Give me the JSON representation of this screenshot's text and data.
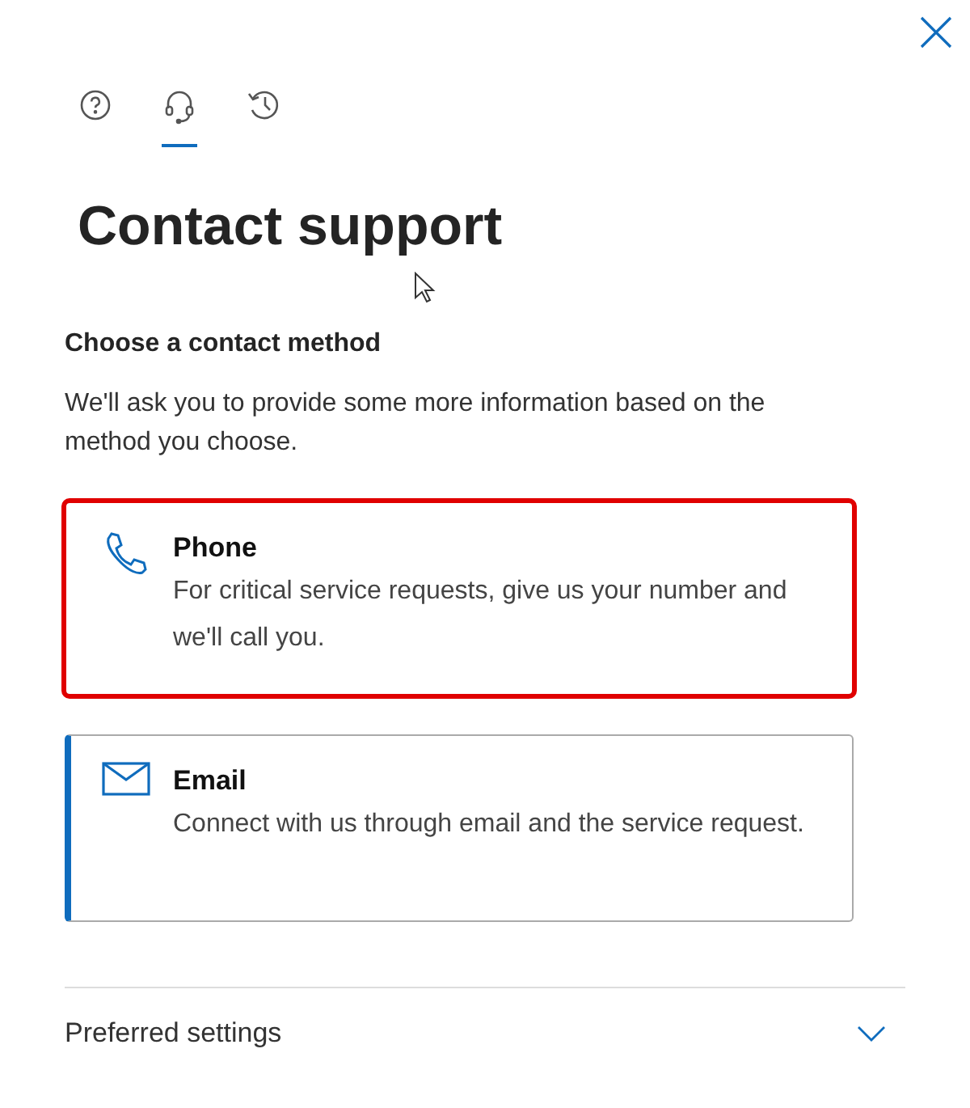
{
  "tabs": [
    {
      "kind": "help",
      "selected": false
    },
    {
      "kind": "support",
      "selected": true
    },
    {
      "kind": "history",
      "selected": false
    }
  ],
  "title": "Contact support",
  "section": {
    "heading": "Choose a contact method",
    "description": "We'll ask you to provide some more information based on the method you choose."
  },
  "methods": [
    {
      "kind": "phone",
      "title": "Phone",
      "description": "For critical service requests, give us your number and we'll call you.",
      "highlighted": true,
      "selected": false
    },
    {
      "kind": "email",
      "title": "Email",
      "description": "Connect with us through email and the service request.",
      "highlighted": false,
      "selected": true
    }
  ],
  "preferred_settings": {
    "label": "Preferred settings",
    "expanded": false
  }
}
